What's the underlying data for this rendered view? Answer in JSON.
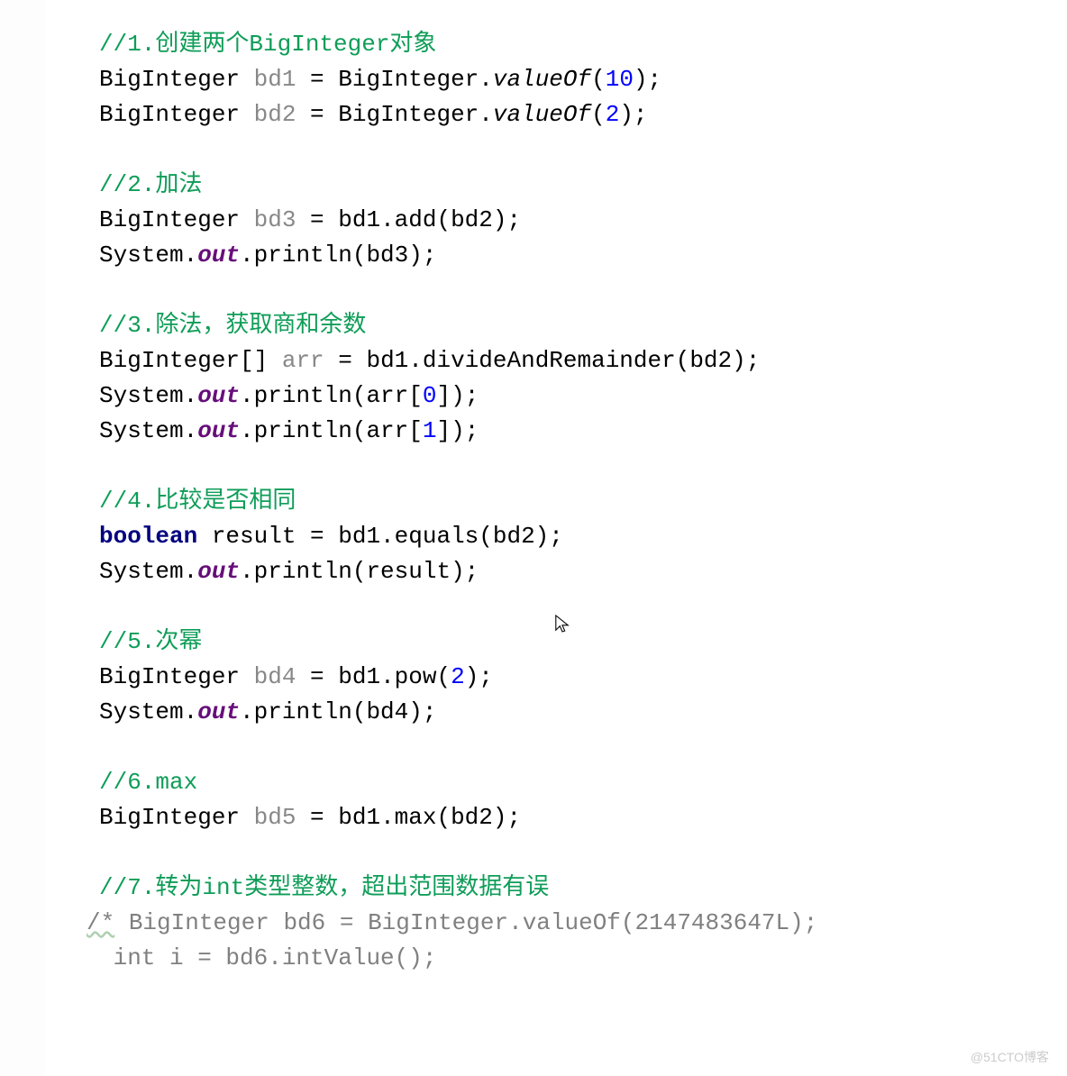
{
  "code": {
    "c1": "//1.创建两个BigInteger对象",
    "l1a": "BigInteger ",
    "l1b": "bd1",
    "l1c": " = BigInteger.",
    "l1d": "valueOf",
    "l1e": "(",
    "l1f": "10",
    "l1g": ");",
    "l2a": "BigInteger ",
    "l2b": "bd2",
    "l2c": " = BigInteger.",
    "l2d": "valueOf",
    "l2e": "(",
    "l2f": "2",
    "l2g": ");",
    "c2": "//2.加法",
    "l3a": "BigInteger ",
    "l3b": "bd3",
    "l3c": " = bd1.add(bd2);",
    "l4a": "System.",
    "l4b": "out",
    "l4c": ".println(bd3);",
    "c3": "//3.除法，获取商和余数",
    "l5a": "BigInteger[] ",
    "l5b": "arr",
    "l5c": " = bd1.divideAndRemainder(bd2);",
    "l6a": "System.",
    "l6b": "out",
    "l6c": ".println(arr[",
    "l6d": "0",
    "l6e": "]);",
    "l7a": "System.",
    "l7b": "out",
    "l7c": ".println(arr[",
    "l7d": "1",
    "l7e": "]);",
    "c4": "//4.比较是否相同",
    "l8a": "boolean",
    "l8b": " result = bd1.equals(bd2);",
    "l9a": "System.",
    "l9b": "out",
    "l9c": ".println(result);",
    "c5": "//5.次幂",
    "l10a": "BigInteger ",
    "l10b": "bd4",
    "l10c": " = bd1.pow(",
    "l10d": "2",
    "l10e": ");",
    "l11a": "System.",
    "l11b": "out",
    "l11c": ".println(bd4);",
    "c6": "//6.max",
    "l12a": "BigInteger ",
    "l12b": "bd5",
    "l12c": " = bd1.max(bd2);",
    "c7": "//7.转为int类型整数，超出范围数据有误",
    "l13a": "/*",
    "l13b": " BigInteger bd6 = BigInteger.valueOf(2147483647L);",
    "l14": " int i = bd6.intValue();"
  },
  "watermark": "@51CTO博客"
}
